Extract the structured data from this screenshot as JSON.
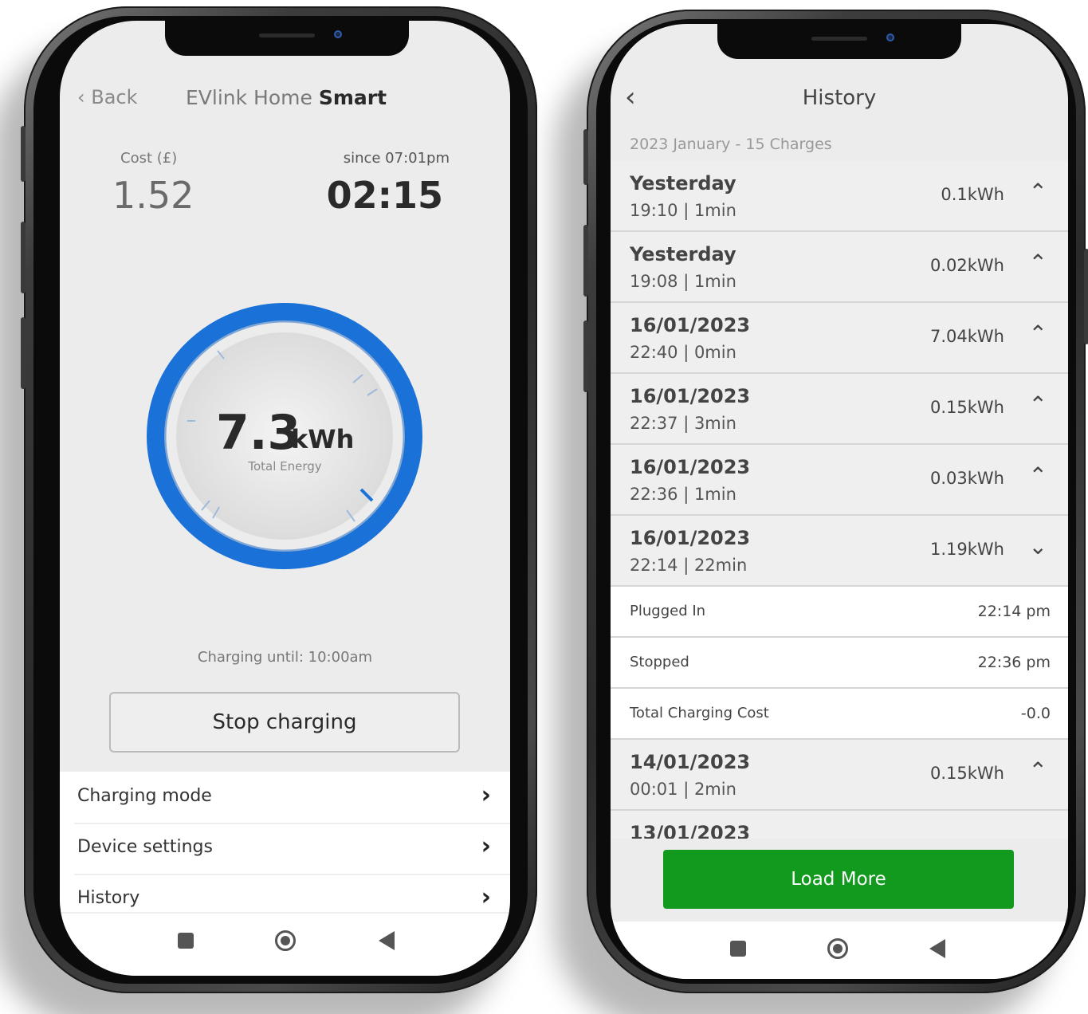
{
  "left_phone": {
    "header": {
      "back_label": "Back",
      "title_prefix": "EVlink Home ",
      "title_bold": "Smart"
    },
    "cost": {
      "label": "Cost (£)",
      "value": "1.52"
    },
    "duration": {
      "label": "since 07:01pm",
      "value": "02:15"
    },
    "energy": {
      "value": "7.3",
      "unit": "kWh",
      "label": "Total Energy"
    },
    "charging_until": "Charging until: 10:00am",
    "stop_button": "Stop charging",
    "menu": [
      {
        "label": "Charging mode",
        "icon": "chevron-right-icon"
      },
      {
        "label": "Device settings",
        "icon": "chevron-right-icon"
      },
      {
        "label": "History",
        "icon": "chevron-right-icon"
      }
    ],
    "accent_color": "#1a72d9"
  },
  "right_phone": {
    "header": {
      "title": "History",
      "back_icon": "chevron-left-icon"
    },
    "subtitle": "2023 January - 15 Charges",
    "rows": [
      {
        "date": "Yesterday",
        "time": "19:10 | 1min",
        "energy": "0.1kWh",
        "chevron": "^"
      },
      {
        "date": "Yesterday",
        "time": "19:08 | 1min",
        "energy": "0.02kWh",
        "chevron": "^"
      },
      {
        "date": "16/01/2023",
        "time": "22:40 | 0min",
        "energy": "7.04kWh",
        "chevron": "^"
      },
      {
        "date": "16/01/2023",
        "time": "22:37 | 3min",
        "energy": "0.15kWh",
        "chevron": "^"
      },
      {
        "date": "16/01/2023",
        "time": "22:36 | 1min",
        "energy": "0.03kWh",
        "chevron": "^"
      },
      {
        "date": "16/01/2023",
        "time": "22:14 | 22min",
        "energy": "1.19kWh",
        "chevron": "v"
      }
    ],
    "details": [
      {
        "label": "Plugged In",
        "value": "22:14 pm"
      },
      {
        "label": "Stopped",
        "value": "22:36 pm"
      },
      {
        "label": "Total Charging Cost",
        "value": "-0.0"
      }
    ],
    "rows_after": [
      {
        "date": "14/01/2023",
        "time": "00:01 | 2min",
        "energy": "0.15kWh",
        "chevron": "^"
      },
      {
        "date": "13/01/2023",
        "time": "",
        "energy": "",
        "chevron": ""
      }
    ],
    "load_more": "Load More",
    "button_color": "#129a1f"
  }
}
